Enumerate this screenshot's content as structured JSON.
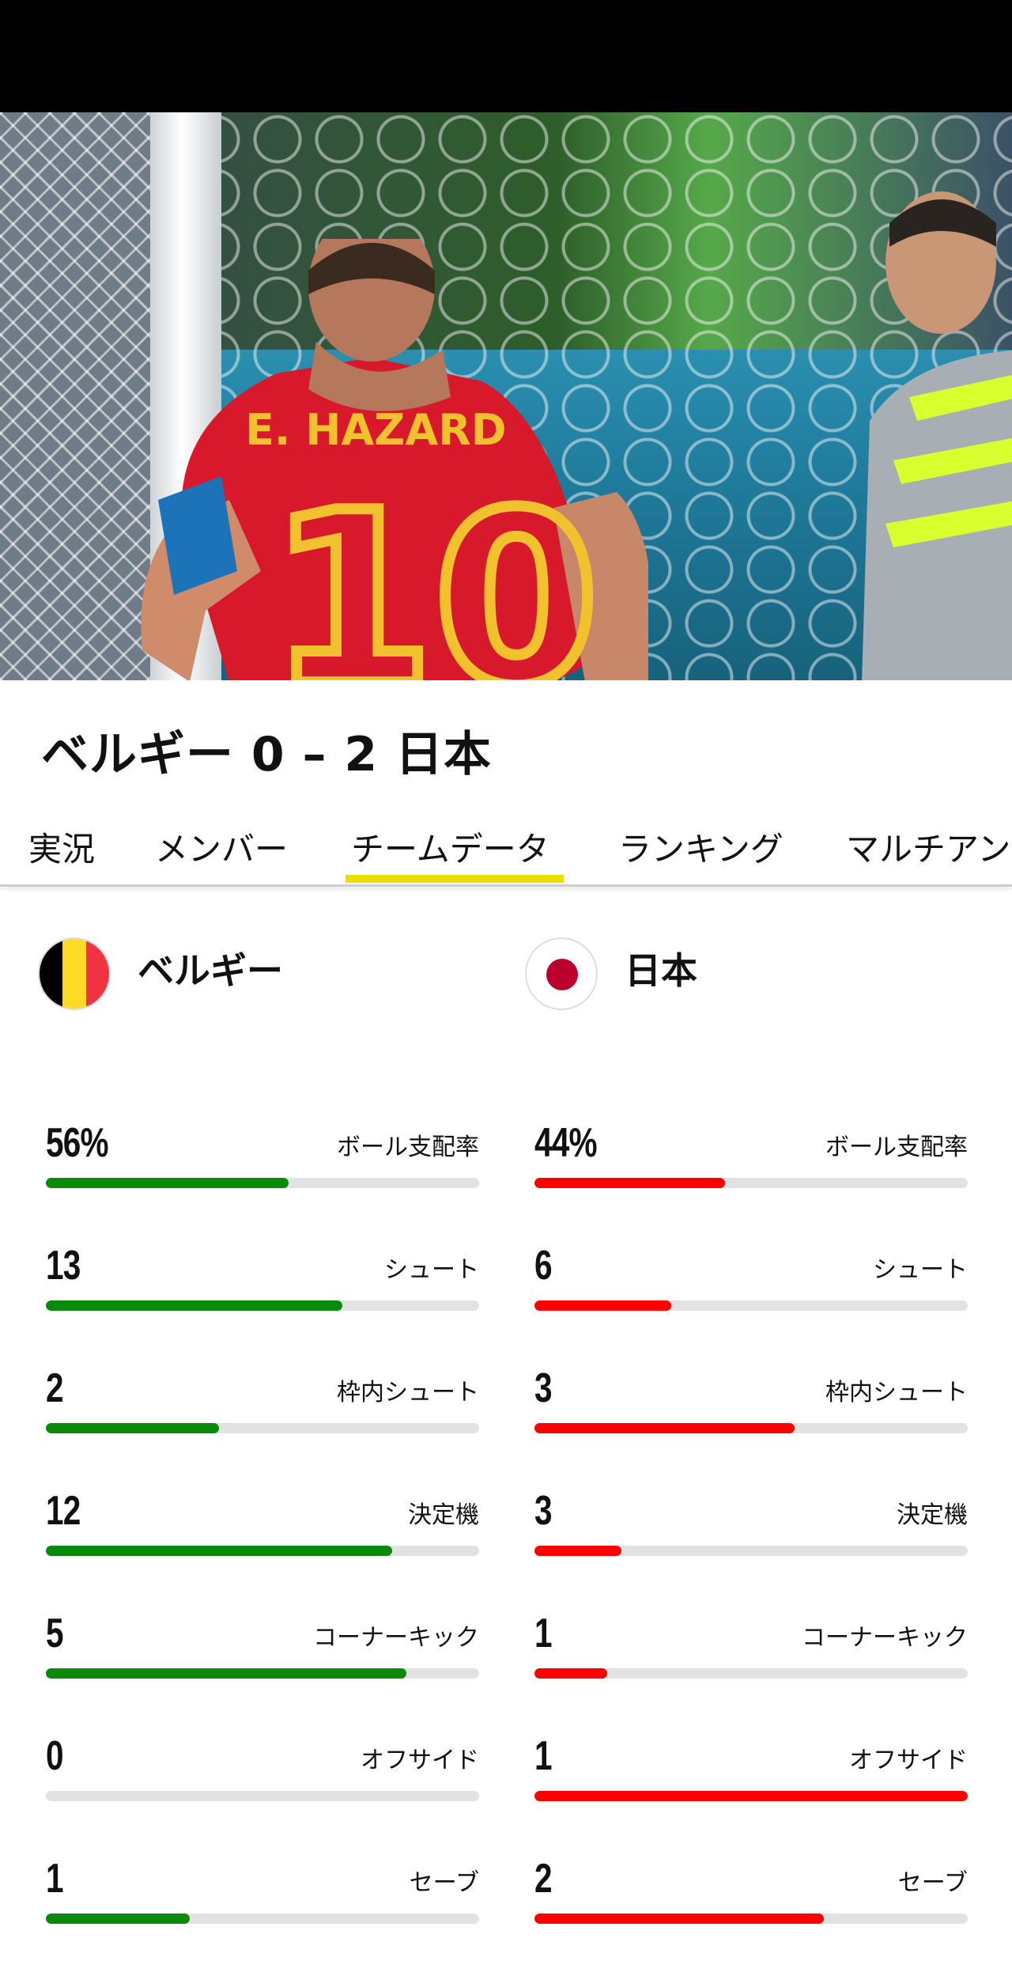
{
  "match": {
    "title": "ベルギー 0 – 2 日本"
  },
  "hero": {
    "jersey_name": "E. HAZARD",
    "jersey_number": "10"
  },
  "tabs": [
    {
      "label": "実況"
    },
    {
      "label": "メンバー"
    },
    {
      "label": "チームデータ",
      "active": true
    },
    {
      "label": "ランキング"
    },
    {
      "label": "マルチアン"
    }
  ],
  "colors": {
    "accent": "#e8df00",
    "home_bar": "#0a8a0a",
    "away_bar": "#ff0000",
    "track": "#e2e2e2"
  },
  "home": {
    "name": "ベルギー",
    "flag": [
      "#000000",
      "#fdda24",
      "#ef3340"
    ],
    "stats": [
      {
        "value": "56%",
        "label": "ボール支配率",
        "ratio": 0.56
      },
      {
        "value": "13",
        "label": "シュート",
        "ratio": 0.684
      },
      {
        "value": "2",
        "label": "枠内シュート",
        "ratio": 0.4
      },
      {
        "value": "12",
        "label": "決定機",
        "ratio": 0.8
      },
      {
        "value": "5",
        "label": "コーナーキック",
        "ratio": 0.833
      },
      {
        "value": "0",
        "label": "オフサイド",
        "ratio": 0.0
      },
      {
        "value": "1",
        "label": "セーブ",
        "ratio": 0.333
      }
    ]
  },
  "away": {
    "name": "日本",
    "flag": [
      "#ffffff",
      "#bc002d"
    ],
    "stats": [
      {
        "value": "44%",
        "label": "ボール支配率",
        "ratio": 0.44
      },
      {
        "value": "6",
        "label": "シュート",
        "ratio": 0.316
      },
      {
        "value": "3",
        "label": "枠内シュート",
        "ratio": 0.6
      },
      {
        "value": "3",
        "label": "決定機",
        "ratio": 0.2
      },
      {
        "value": "1",
        "label": "コーナーキック",
        "ratio": 0.167
      },
      {
        "value": "1",
        "label": "オフサイド",
        "ratio": 1.0
      },
      {
        "value": "2",
        "label": "セーブ",
        "ratio": 0.667
      }
    ]
  }
}
